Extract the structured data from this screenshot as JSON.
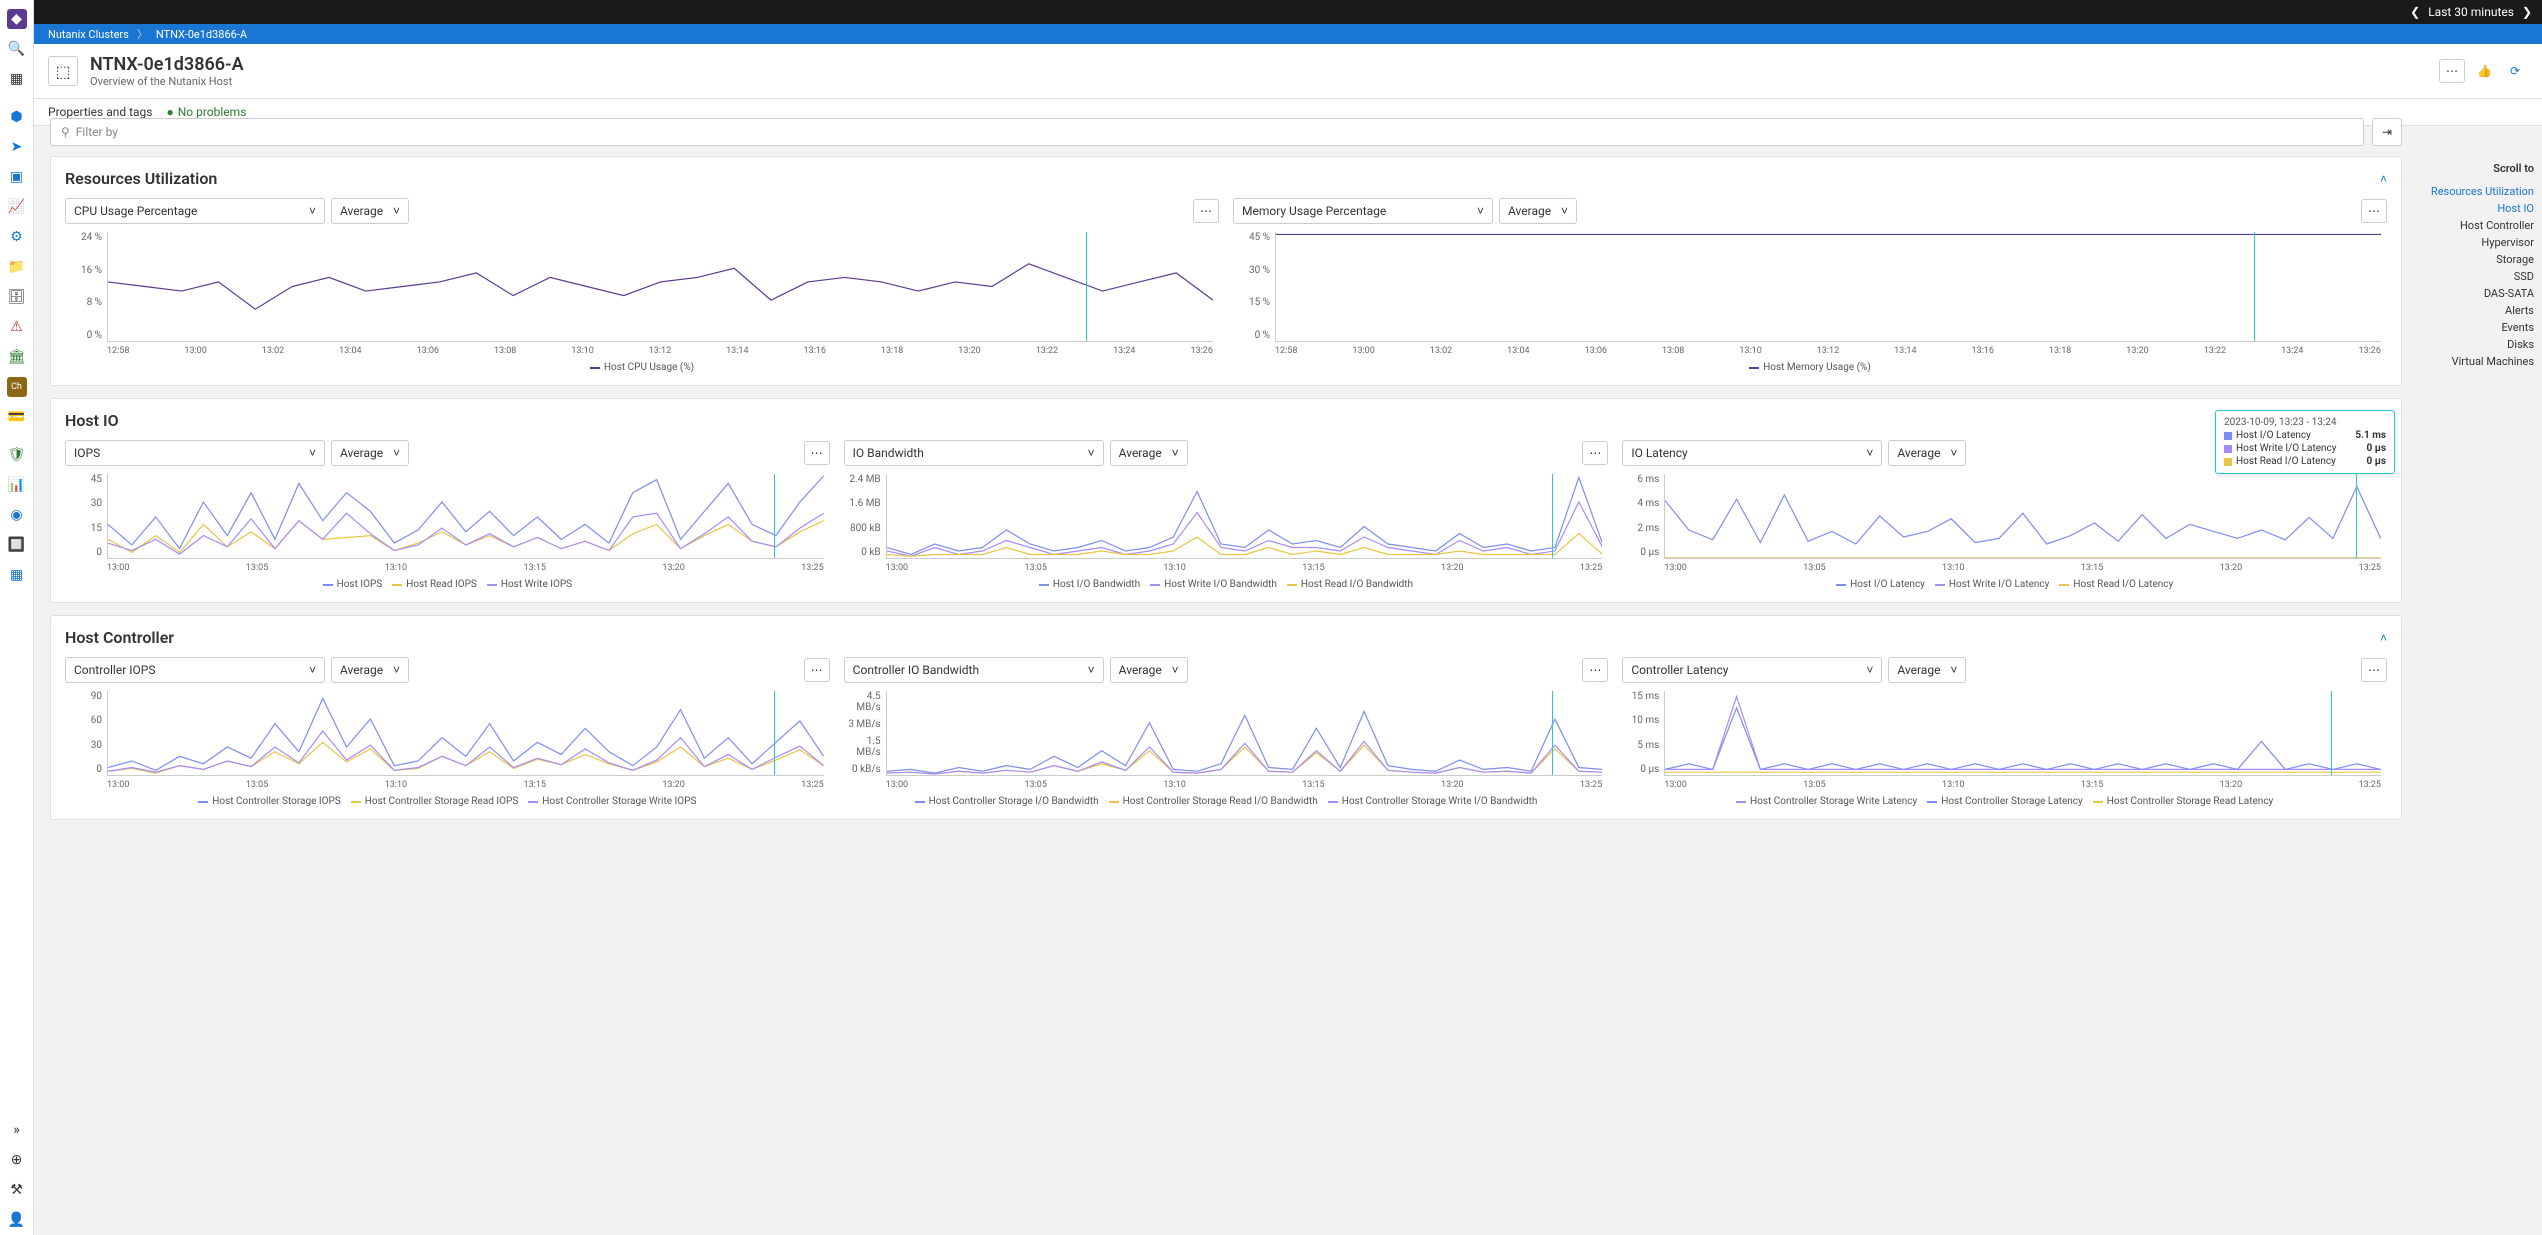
{
  "topbar": {
    "range_label": "Last 30 minutes"
  },
  "breadcrumb": {
    "root": "Nutanix Clusters",
    "leaf": "NTNX-0e1d3866-A"
  },
  "header": {
    "title": "NTNX-0e1d3866-A",
    "subtitle": "Overview of the Nutanix Host"
  },
  "props": {
    "tags_label": "Properties and tags",
    "health_label": "No problems"
  },
  "filter": {
    "placeholder": "Filter by"
  },
  "agg_label": "Average",
  "scroll_nav": {
    "title": "Scroll to",
    "items": [
      "Resources Utilization",
      "Host IO",
      "Host Controller",
      "Hypervisor",
      "Storage",
      "SSD",
      "DAS-SATA",
      "Alerts",
      "Events",
      "Disks",
      "Virtual Machines"
    ],
    "active": [
      0,
      1
    ]
  },
  "sections": {
    "resources": {
      "title": "Resources Utilization"
    },
    "hostio": {
      "title": "Host IO"
    },
    "hostctrl": {
      "title": "Host Controller"
    }
  },
  "charts": {
    "cpu": {
      "metric_label": "CPU Usage Percentage",
      "legend": "Host CPU Usage (%)"
    },
    "mem": {
      "metric_label": "Memory Usage Percentage",
      "legend": "Host Memory Usage (%)"
    },
    "iops": {
      "metric_label": "IOPS",
      "legend": [
        "Host IOPS",
        "Host Read IOPS",
        "Host Write IOPS"
      ]
    },
    "iobw": {
      "metric_label": "IO Bandwidth",
      "legend": [
        "Host I/O Bandwidth",
        "Host Write I/O Bandwidth",
        "Host Read I/O Bandwidth"
      ]
    },
    "iolat": {
      "metric_label": "IO Latency",
      "legend": [
        "Host I/O Latency",
        "Host Write I/O Latency",
        "Host Read I/O Latency"
      ]
    },
    "ciops": {
      "metric_label": "Controller IOPS",
      "legend": [
        "Host Controller Storage IOPS",
        "Host Controller Storage Read IOPS",
        "Host Controller Storage Write IOPS"
      ]
    },
    "cbw": {
      "metric_label": "Controller IO Bandwidth",
      "legend": [
        "Host Controller Storage I/O Bandwidth",
        "Host Controller Storage Read I/O Bandwidth",
        "Host Controller Storage Write I/O Bandwidth"
      ]
    },
    "clat": {
      "metric_label": "Controller Latency",
      "legend": [
        "Host Controller Storage Write Latency",
        "Host Controller Storage Latency",
        "Host Controller Storage Read Latency"
      ]
    }
  },
  "ticks_wide": [
    "12:58",
    "13:00",
    "13:02",
    "13:04",
    "13:06",
    "13:08",
    "13:10",
    "13:12",
    "13:14",
    "13:16",
    "13:18",
    "13:20",
    "13:22",
    "13:24",
    "13:26"
  ],
  "ticks_narrow": [
    "13:00",
    "13:05",
    "13:10",
    "13:15",
    "13:20",
    "13:25"
  ],
  "tooltip": {
    "time": "2023-10-09, 13:23 - 13:24",
    "rows": [
      {
        "label": "Host I/O Latency",
        "value": "5.1 ms",
        "color": "#7e8ef0"
      },
      {
        "label": "Host Write I/O Latency",
        "value": "0 µs",
        "color": "#a78bfa"
      },
      {
        "label": "Host Read I/O Latency",
        "value": "0 µs",
        "color": "#e8c547"
      }
    ]
  },
  "chart_data": [
    {
      "id": "cpu",
      "type": "line",
      "title": "CPU Usage Percentage",
      "xlabel": "",
      "ylabel": "%",
      "ylim": [
        0,
        24
      ],
      "yticks": [
        "24 %",
        "16 %",
        "8 %",
        "0 %"
      ],
      "x": [
        "12:58",
        "13:00",
        "13:02",
        "13:04",
        "13:06",
        "13:08",
        "13:10",
        "13:12",
        "13:14",
        "13:16",
        "13:18",
        "13:20",
        "13:22",
        "13:24",
        "13:26"
      ],
      "series": [
        {
          "name": "Host CPU Usage (%)",
          "color": "#5b3a8f",
          "values": [
            13,
            12,
            11,
            13,
            7,
            12,
            14,
            11,
            12,
            13,
            15,
            10,
            14,
            12,
            10,
            13,
            14,
            16,
            9,
            13,
            14,
            13,
            11,
            13,
            12,
            17,
            14,
            11,
            13,
            15,
            9
          ]
        }
      ]
    },
    {
      "id": "mem",
      "type": "line",
      "title": "Memory Usage Percentage",
      "xlabel": "",
      "ylabel": "%",
      "ylim": [
        0,
        45
      ],
      "yticks": [
        "45 %",
        "30 %",
        "15 %",
        "0 %"
      ],
      "x": [
        "12:58",
        "13:00",
        "13:02",
        "13:04",
        "13:06",
        "13:08",
        "13:10",
        "13:12",
        "13:14",
        "13:16",
        "13:18",
        "13:20",
        "13:22",
        "13:24",
        "13:26"
      ],
      "series": [
        {
          "name": "Host Memory Usage (%)",
          "color": "#5b3a8f",
          "values": [
            44,
            44,
            44,
            44,
            44,
            44,
            44,
            44,
            44,
            44,
            44,
            44,
            44,
            44,
            44
          ]
        }
      ]
    },
    {
      "id": "iops",
      "type": "line",
      "title": "IOPS",
      "xlabel": "",
      "ylabel": "",
      "ylim": [
        0,
        45
      ],
      "yticks": [
        "45",
        "30",
        "15",
        "0"
      ],
      "x": [
        "13:00",
        "13:05",
        "13:10",
        "13:15",
        "13:20",
        "13:25"
      ],
      "series": [
        {
          "name": "Host IOPS",
          "color": "#7e8ef0",
          "values": [
            18,
            7,
            22,
            5,
            30,
            12,
            35,
            10,
            40,
            20,
            35,
            25,
            8,
            15,
            30,
            14,
            25,
            12,
            22,
            10,
            18,
            8,
            35,
            42,
            10,
            25,
            40,
            18,
            12,
            30,
            44
          ]
        },
        {
          "name": "Host Read IOPS",
          "color": "#e8c547",
          "values": [
            10,
            3,
            12,
            3,
            18,
            6,
            14,
            5,
            20,
            10,
            11,
            12,
            4,
            8,
            14,
            7,
            12,
            6,
            11,
            5,
            9,
            4,
            13,
            18,
            5,
            12,
            18,
            9,
            6,
            14,
            20
          ]
        },
        {
          "name": "Host Write IOPS",
          "color": "#a78bfa",
          "values": [
            8,
            4,
            10,
            2,
            12,
            6,
            21,
            5,
            20,
            10,
            24,
            13,
            4,
            7,
            16,
            7,
            13,
            6,
            11,
            5,
            9,
            4,
            22,
            24,
            5,
            13,
            22,
            9,
            6,
            16,
            24
          ]
        }
      ]
    },
    {
      "id": "iobw",
      "type": "line",
      "title": "IO Bandwidth",
      "xlabel": "",
      "ylabel": "",
      "ylim": [
        0,
        2.4
      ],
      "yticks": [
        "2.4 MB",
        "1.6 MB",
        "800 kB",
        "0 kB"
      ],
      "x": [
        "13:00",
        "13:05",
        "13:10",
        "13:15",
        "13:20",
        "13:25"
      ],
      "series": [
        {
          "name": "Host I/O Bandwidth",
          "color": "#7e8ef0",
          "values": [
            0.3,
            0.1,
            0.4,
            0.2,
            0.3,
            0.8,
            0.4,
            0.2,
            0.3,
            0.5,
            0.2,
            0.3,
            0.6,
            1.9,
            0.4,
            0.3,
            0.8,
            0.4,
            0.5,
            0.3,
            0.9,
            0.4,
            0.3,
            0.2,
            0.7,
            0.3,
            0.4,
            0.2,
            0.3,
            2.3,
            0.4
          ]
        },
        {
          "name": "Host Write I/O Bandwidth",
          "color": "#a78bfa",
          "values": [
            0.2,
            0.05,
            0.3,
            0.1,
            0.2,
            0.5,
            0.3,
            0.1,
            0.2,
            0.3,
            0.1,
            0.2,
            0.4,
            1.3,
            0.3,
            0.2,
            0.5,
            0.3,
            0.3,
            0.2,
            0.6,
            0.3,
            0.2,
            0.1,
            0.5,
            0.2,
            0.3,
            0.1,
            0.2,
            1.6,
            0.3
          ]
        },
        {
          "name": "Host Read I/O Bandwidth",
          "color": "#e8c547",
          "values": [
            0.1,
            0.05,
            0.1,
            0.1,
            0.1,
            0.3,
            0.1,
            0.1,
            0.1,
            0.2,
            0.1,
            0.1,
            0.2,
            0.6,
            0.1,
            0.1,
            0.3,
            0.1,
            0.2,
            0.1,
            0.3,
            0.1,
            0.1,
            0.1,
            0.2,
            0.1,
            0.1,
            0.1,
            0.1,
            0.7,
            0.1
          ]
        }
      ]
    },
    {
      "id": "iolat",
      "type": "line",
      "title": "IO Latency",
      "xlabel": "",
      "ylabel": "",
      "ylim": [
        0,
        6
      ],
      "yticks": [
        "6 ms",
        "4 ms",
        "2 ms",
        "0 µs"
      ],
      "x": [
        "13:00",
        "13:05",
        "13:10",
        "13:15",
        "13:20",
        "13:25"
      ],
      "series": [
        {
          "name": "Host I/O Latency",
          "color": "#7e8ef0",
          "values": [
            4.1,
            2.0,
            1.3,
            4.2,
            1.1,
            4.5,
            1.2,
            1.9,
            1.0,
            3.0,
            1.5,
            1.9,
            2.8,
            1.1,
            1.4,
            3.2,
            1.0,
            1.6,
            2.5,
            1.2,
            3.1,
            1.4,
            2.4,
            1.9,
            1.4,
            2.0,
            1.3,
            2.9,
            1.4,
            5.1,
            1.4
          ]
        },
        {
          "name": "Host Write I/O Latency",
          "color": "#a78bfa",
          "values": [
            0,
            0,
            0,
            0,
            0,
            0,
            0,
            0,
            0,
            0,
            0,
            0,
            0,
            0,
            0,
            0,
            0,
            0,
            0,
            0,
            0,
            0,
            0,
            0,
            0,
            0,
            0,
            0,
            0,
            0,
            0
          ]
        },
        {
          "name": "Host Read I/O Latency",
          "color": "#e8c547",
          "values": [
            0,
            0,
            0,
            0,
            0,
            0,
            0,
            0,
            0,
            0,
            0,
            0,
            0,
            0,
            0,
            0,
            0,
            0,
            0,
            0,
            0,
            0,
            0,
            0,
            0,
            0,
            0,
            0,
            0,
            0,
            0
          ]
        }
      ]
    },
    {
      "id": "ciops",
      "type": "line",
      "title": "Controller IOPS",
      "xlabel": "",
      "ylabel": "",
      "ylim": [
        0,
        90
      ],
      "yticks": [
        "90",
        "60",
        "30",
        "0"
      ],
      "x": [
        "13:00",
        "13:05",
        "13:10",
        "13:15",
        "13:20",
        "13:25"
      ],
      "series": [
        {
          "name": "Host Controller Storage IOPS",
          "color": "#7e8ef0",
          "values": [
            8,
            15,
            5,
            20,
            12,
            30,
            18,
            55,
            25,
            82,
            30,
            60,
            10,
            15,
            40,
            20,
            55,
            15,
            35,
            22,
            50,
            25,
            10,
            30,
            70,
            18,
            40,
            12,
            35,
            58,
            20
          ]
        },
        {
          "name": "Host Controller Storage Read IOPS",
          "color": "#e8c547",
          "values": [
            4,
            7,
            2,
            10,
            6,
            15,
            9,
            25,
            12,
            35,
            14,
            28,
            5,
            7,
            20,
            10,
            25,
            7,
            17,
            11,
            22,
            12,
            5,
            14,
            30,
            9,
            18,
            6,
            16,
            27,
            10
          ]
        },
        {
          "name": "Host Controller Storage Write IOPS",
          "color": "#a78bfa",
          "values": [
            4,
            8,
            3,
            10,
            6,
            15,
            9,
            30,
            13,
            47,
            16,
            32,
            5,
            8,
            20,
            10,
            30,
            8,
            18,
            11,
            28,
            13,
            5,
            16,
            40,
            9,
            22,
            6,
            19,
            31,
            10
          ]
        }
      ]
    },
    {
      "id": "cbw",
      "type": "line",
      "title": "Controller IO Bandwidth",
      "xlabel": "",
      "ylabel": "",
      "ylim": [
        0,
        4.5
      ],
      "yticks": [
        "4.5 MB/s",
        "3 MB/s",
        "1.5 MB/s",
        "0 kB/s"
      ],
      "x": [
        "13:00",
        "13:05",
        "13:10",
        "13:15",
        "13:20",
        "13:25"
      ],
      "series": [
        {
          "name": "Host Controller Storage I/O Bandwidth",
          "color": "#7e8ef0",
          "values": [
            0.2,
            0.3,
            0.1,
            0.4,
            0.2,
            0.5,
            0.3,
            1.0,
            0.4,
            1.3,
            0.5,
            2.8,
            0.3,
            0.2,
            0.6,
            3.2,
            0.4,
            0.3,
            2.5,
            0.4,
            3.4,
            0.5,
            0.3,
            0.2,
            0.8,
            0.3,
            0.4,
            0.2,
            3.0,
            0.4,
            0.3
          ]
        },
        {
          "name": "Host Controller Storage Read I/O Bandwidth",
          "color": "#e8c547",
          "values": [
            0.1,
            0.15,
            0.05,
            0.2,
            0.1,
            0.25,
            0.15,
            0.5,
            0.2,
            0.6,
            0.25,
            1.3,
            0.15,
            0.1,
            0.3,
            1.5,
            0.2,
            0.15,
            1.2,
            0.2,
            1.6,
            0.25,
            0.15,
            0.1,
            0.4,
            0.15,
            0.2,
            0.1,
            1.4,
            0.2,
            0.15
          ]
        },
        {
          "name": "Host Controller Storage Write I/O Bandwidth",
          "color": "#a78bfa",
          "values": [
            0.1,
            0.15,
            0.05,
            0.2,
            0.1,
            0.25,
            0.15,
            0.5,
            0.2,
            0.7,
            0.25,
            1.5,
            0.15,
            0.1,
            0.3,
            1.7,
            0.2,
            0.15,
            1.3,
            0.2,
            1.8,
            0.25,
            0.15,
            0.1,
            0.4,
            0.15,
            0.2,
            0.1,
            1.6,
            0.2,
            0.15
          ]
        }
      ]
    },
    {
      "id": "clat",
      "type": "line",
      "title": "Controller Latency",
      "xlabel": "",
      "ylabel": "",
      "ylim": [
        0,
        15
      ],
      "yticks": [
        "15 ms",
        "10 ms",
        "5 ms",
        "0 µs"
      ],
      "x": [
        "13:00",
        "13:05",
        "13:10",
        "13:15",
        "13:20",
        "13:25"
      ],
      "series": [
        {
          "name": "Host Controller Storage Write Latency",
          "color": "#a78bfa",
          "values": [
            1,
            1,
            1,
            14,
            1,
            1,
            1,
            1,
            1,
            1,
            1,
            1,
            1,
            1,
            1,
            1,
            1,
            1,
            1,
            1,
            1,
            1,
            1,
            1,
            1,
            1,
            1,
            1,
            1,
            1,
            1
          ]
        },
        {
          "name": "Host Controller Storage Latency",
          "color": "#7e8ef0",
          "values": [
            1,
            2,
            1,
            12,
            1,
            2,
            1,
            2,
            1,
            2,
            1,
            2,
            1,
            2,
            1,
            2,
            1,
            2,
            1,
            2,
            1,
            2,
            1,
            2,
            1,
            6,
            1,
            2,
            1,
            2,
            1
          ]
        },
        {
          "name": "Host Controller Storage Read Latency",
          "color": "#e8c547",
          "values": [
            0.5,
            0.5,
            0.5,
            0.5,
            0.5,
            0.5,
            0.5,
            0.5,
            0.5,
            0.5,
            0.5,
            0.5,
            0.5,
            0.5,
            0.5,
            0.5,
            0.5,
            0.5,
            0.5,
            0.5,
            0.5,
            0.5,
            0.5,
            0.5,
            0.5,
            0.5,
            0.5,
            0.5,
            0.5,
            0.5,
            0.5
          ]
        }
      ]
    }
  ]
}
